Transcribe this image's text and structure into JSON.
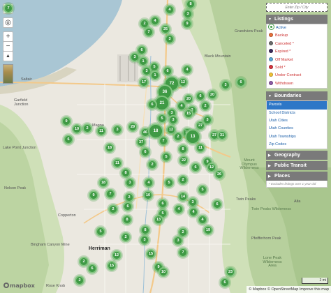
{
  "controls": {
    "search_icon": "search-icon",
    "locate_icon": "crosshair-icon",
    "zoom_in": "+",
    "zoom_out": "−",
    "compass": "▲"
  },
  "panel": {
    "search_placeholder": "Enter Zip / City",
    "listings": {
      "title": "Listings",
      "items": [
        {
          "label": "Active",
          "color": "#3f9a45",
          "active": true
        },
        {
          "label": "Backup",
          "color": "#e8703a"
        },
        {
          "label": "Canceled *",
          "color": "#6b6b6b"
        },
        {
          "label": "Expired *",
          "color": "#3a2a5a"
        },
        {
          "label": "Off Market",
          "color": "#5aa7d6"
        },
        {
          "label": "Sold *",
          "color": "#d6343e"
        },
        {
          "label": "Under Contract",
          "color": "#f2c234"
        },
        {
          "label": "Withdrawn",
          "color": "#8e5aa7"
        }
      ]
    },
    "boundaries": {
      "title": "Boundaries",
      "items": [
        "Parcels",
        "School Districts",
        "Utah Cities",
        "Utah Counties",
        "Utah Townships",
        "Zip Codes"
      ]
    },
    "collapsed": [
      "Geography",
      "Public Transit",
      "Places"
    ],
    "note": "* Excludes listings over 1 year old"
  },
  "places": [
    {
      "text": "Saltair",
      "big": false
    },
    {
      "text": "Garfield Junction",
      "big": false
    },
    {
      "text": "Lake Point Junction",
      "big": false
    },
    {
      "text": "Magna",
      "big": false
    },
    {
      "text": "Nelson Peak",
      "big": false
    },
    {
      "text": "Copperton",
      "big": false
    },
    {
      "text": "Herriman",
      "big": true
    },
    {
      "text": "Bingham Canyon Mine",
      "big": false
    },
    {
      "text": "Black Mountain",
      "big": false
    },
    {
      "text": "Grandview Peak",
      "big": false
    },
    {
      "text": "Mount Olympus Wilderness",
      "big": false
    },
    {
      "text": "Twin Peaks Wilderness",
      "big": false
    },
    {
      "text": "Lone Peak Wilderness Area",
      "big": false
    },
    {
      "text": "Pfeifferhorn Peak",
      "big": false
    },
    {
      "text": "Twin Peaks",
      "big": false
    },
    {
      "text": "Alta",
      "big": false
    },
    {
      "text": "Rose Knob",
      "big": false
    }
  ],
  "clusters": [
    "7",
    "4",
    "8",
    "3",
    "9",
    "2",
    "25",
    "3",
    "4",
    "7",
    "6",
    "3",
    "1",
    "5",
    "3",
    "6",
    "1",
    "4",
    "17",
    "72",
    "12",
    "36",
    "21",
    "6",
    "6",
    "20",
    "3",
    "6",
    "20",
    "4",
    "3",
    "2",
    "3",
    "15",
    "3",
    "3",
    "9",
    "2",
    "10",
    "11",
    "29",
    "46",
    "18",
    "12",
    "13",
    "27",
    "31",
    "6",
    "3",
    "5",
    "27",
    "2",
    "13",
    "37",
    "7",
    "11",
    "18",
    "6",
    "8",
    "22",
    "5",
    "9",
    "12",
    "11",
    "2",
    "8",
    "6",
    "26",
    "2",
    "5",
    "18",
    "4",
    "3",
    "5",
    "7",
    "9",
    "10",
    "14",
    "2",
    "6",
    "6",
    "3",
    "6",
    "2",
    "4",
    "5",
    "4",
    "4",
    "19",
    "8",
    "13",
    "8",
    "2",
    "3",
    "2",
    "5",
    "3",
    "7",
    "12",
    "15",
    "2",
    "6",
    "15",
    "9",
    "10",
    "23",
    "6",
    "2"
  ],
  "scale": "2 mi",
  "attribution": "© Mapbox © OpenStreetMap Improve this map",
  "logo": "mapbox"
}
